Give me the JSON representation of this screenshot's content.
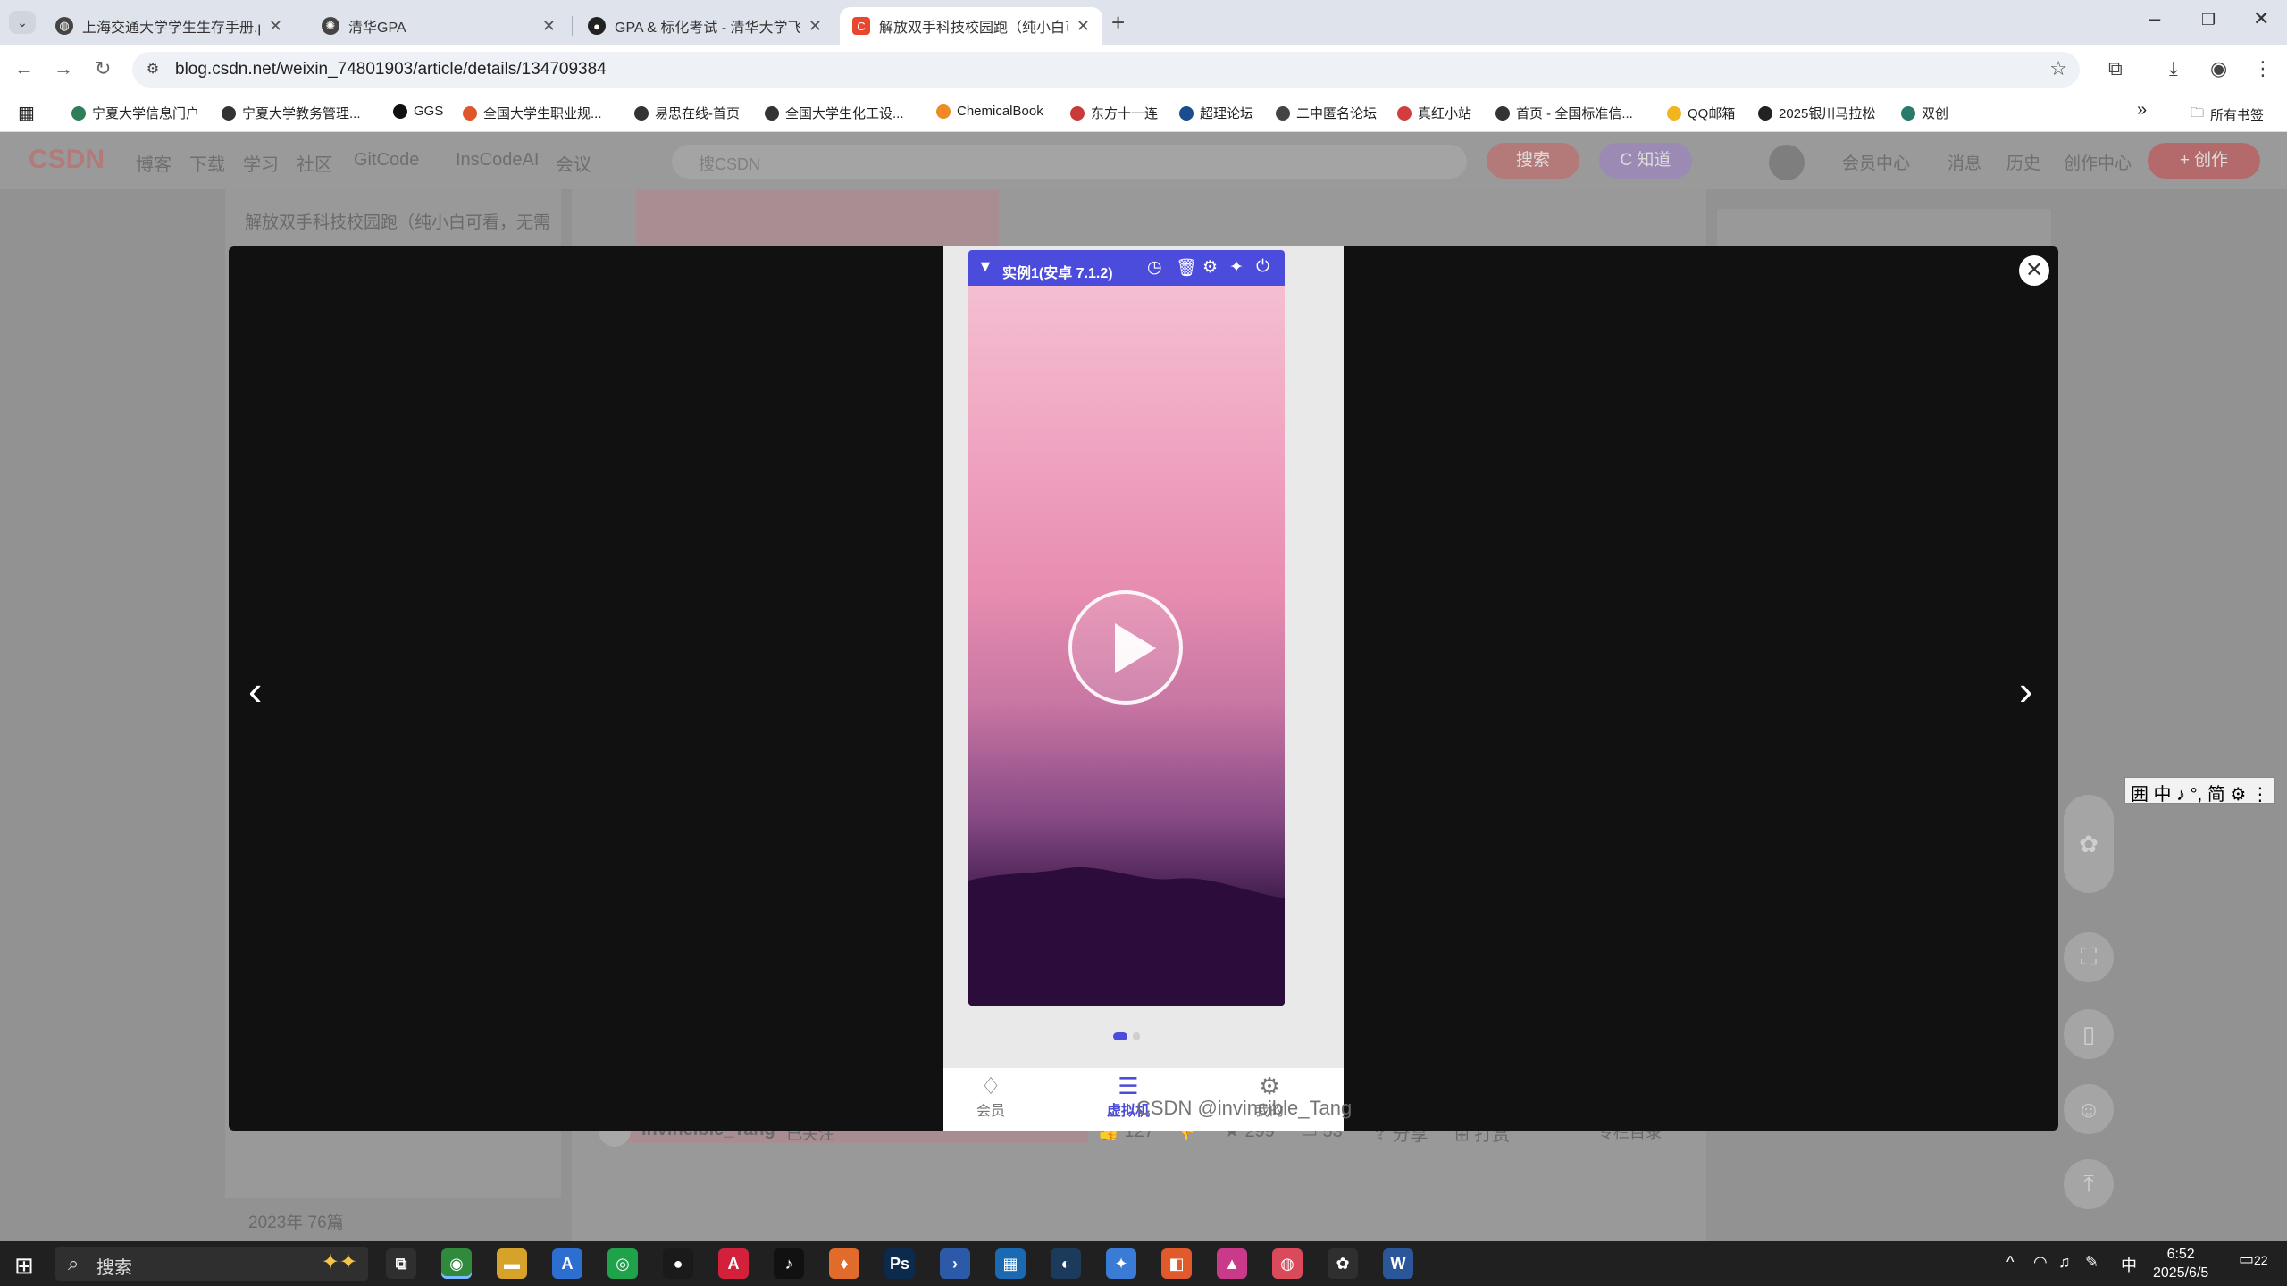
{
  "browser": {
    "tabs": [
      {
        "label": "上海交通大学学生生存手册.pdf",
        "icon": "globe-icon",
        "active": false
      },
      {
        "label": "清华GPA",
        "icon": "openai-icon",
        "active": false
      },
      {
        "label": "GPA & 标化考试 - 清华大学飞跃...",
        "icon": "github-icon",
        "active": false
      },
      {
        "label": "解放双手科技校园跑（纯小白可看，无需...",
        "icon": "csdn-icon",
        "active": true
      }
    ],
    "tab_close_symbol": "✕",
    "new_tab_symbol": "+",
    "url": "blog.csdn.net/weixin_74801903/article/details/134709384",
    "bookmarks": [
      {
        "label": "宁夏大学信息门户",
        "color": "#2e7d5b"
      },
      {
        "label": "宁夏大学教务管理...",
        "color": "#333333"
      },
      {
        "label": "GGS",
        "color": "#111111"
      },
      {
        "label": "全国大学生职业规...",
        "color": "#e0562b"
      },
      {
        "label": "易思在线-首页",
        "color": "#333333"
      },
      {
        "label": "全国大学生化工设...",
        "color": "#333333"
      },
      {
        "label": "ChemicalBook",
        "color": "#f08a24"
      },
      {
        "label": "东方十一连",
        "color": "#c93a3a"
      },
      {
        "label": "超理论坛",
        "color": "#1b4c8f"
      },
      {
        "label": "二中匿名论坛",
        "color": "#444444"
      },
      {
        "label": "真红小站",
        "color": "#d23d3d"
      },
      {
        "label": "首页 - 全国标准信...",
        "color": "#333333"
      },
      {
        "label": "QQ邮箱",
        "color": "#f2b51e"
      },
      {
        "label": "2025银川马拉松",
        "color": "#222222"
      },
      {
        "label": "双创",
        "color": "#2a7a6a"
      }
    ],
    "bookmarks_more": "»",
    "all_bookmarks": "所有书签"
  },
  "csdn": {
    "logo": "CSDN",
    "nav": [
      "博客",
      "下载",
      "学习",
      "社区",
      "GitCode",
      "InsCodeAI",
      "会议"
    ],
    "search_placeholder": "搜CSDN",
    "search_button": "搜索",
    "zhidao_button": "C 知道",
    "right_nav": [
      "会员中心",
      "消息",
      "历史",
      "创作中心"
    ],
    "write_button": "+ 创作",
    "left_text_1": "解放双手科技校园跑（纯小白可看，无需",
    "left_text_2": "2023年 76篇",
    "author": "invincible_Tang",
    "follow": "已关注",
    "stats": [
      "127",
      "",
      "299",
      "53",
      "分享",
      "打赏"
    ],
    "column_dir": "专栏目录"
  },
  "viewer": {
    "close_symbol": "✕",
    "prev_symbol": "‹",
    "next_symbol": "›",
    "vm_title": "实例1(安卓 7.1.2)",
    "vm_controls": [
      "clock-icon",
      "trash-icon",
      "settings-icon",
      "pin-icon",
      "power-icon"
    ],
    "phone_nav": [
      {
        "label": "会员",
        "icon": "diamond-icon",
        "active": false
      },
      {
        "label": "虚拟机",
        "icon": "server-icon",
        "active": true
      },
      {
        "label": "我的",
        "icon": "gear-icon",
        "active": false
      }
    ],
    "watermark": "CSDN @invincible_Tang",
    "accent": "#4c4cdc"
  },
  "ime": "囲 中 ♪ °, 简 ⚙ ⋮",
  "taskbar": {
    "search_placeholder": "搜索",
    "apps": [
      {
        "name": "task-view",
        "glyph": "⧉",
        "color": "#2f2f2f"
      },
      {
        "name": "chrome",
        "glyph": "◉",
        "color": "#2f8a3b",
        "active": true
      },
      {
        "name": "file-explorer",
        "glyph": "▬",
        "color": "#d6a22a"
      },
      {
        "name": "app-store",
        "glyph": "A",
        "color": "#2c6fd1"
      },
      {
        "name": "wechat",
        "glyph": "◎",
        "color": "#20a24a"
      },
      {
        "name": "qq",
        "glyph": "●",
        "color": "#1a1a1a"
      },
      {
        "name": "acrobat",
        "glyph": "A",
        "color": "#d3213b"
      },
      {
        "name": "tiktok",
        "glyph": "♪",
        "color": "#111111"
      },
      {
        "name": "mic",
        "glyph": "♦",
        "color": "#e06b2a"
      },
      {
        "name": "photoshop",
        "glyph": "Ps",
        "color": "#0b2a4c"
      },
      {
        "name": "powershell",
        "glyph": "›",
        "color": "#2d5aa8"
      },
      {
        "name": "calc",
        "glyph": "▦",
        "color": "#1a6ab3"
      },
      {
        "name": "steam",
        "glyph": "◐",
        "color": "#1b3a5c"
      },
      {
        "name": "gear-app",
        "glyph": "✦",
        "color": "#3a7bd5"
      },
      {
        "name": "app-2",
        "glyph": "◧",
        "color": "#e05a2b"
      },
      {
        "name": "app-3",
        "glyph": "▲",
        "color": "#c93a8a"
      },
      {
        "name": "app-4",
        "glyph": "◍",
        "color": "#d94a5a"
      },
      {
        "name": "app-5",
        "glyph": "✿",
        "color": "#2f2f2f"
      },
      {
        "name": "word",
        "glyph": "W",
        "color": "#2b579a"
      }
    ],
    "lang": "中",
    "time": "6:52",
    "date": "2025/6/5",
    "notifications": "22"
  }
}
